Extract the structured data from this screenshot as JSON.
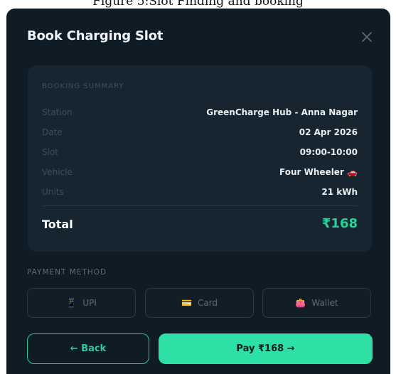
{
  "caption": "Figure 5:Slot Finding and booking",
  "modal": {
    "title": "Book Charging Slot"
  },
  "summary": {
    "heading": "BOOKING SUMMARY",
    "rows": [
      {
        "label": "Station",
        "value": "GreenCharge Hub - Anna Nagar"
      },
      {
        "label": "Date",
        "value": "02 Apr 2026"
      },
      {
        "label": "Slot",
        "value": "09:00-10:00"
      },
      {
        "label": "Vehicle",
        "value": "Four Wheeler 🚗"
      },
      {
        "label": "Units",
        "value": "21 kWh"
      }
    ],
    "total_label": "Total",
    "total_value": "₹168"
  },
  "payment": {
    "heading": "PAYMENT METHOD",
    "options": [
      {
        "icon": "📱",
        "label": "UPI"
      },
      {
        "icon": "💳",
        "label": "Card"
      },
      {
        "icon": "👛",
        "label": "Wallet"
      }
    ]
  },
  "actions": {
    "back_label": "← Back",
    "pay_label": "Pay ₹168 →"
  },
  "colors": {
    "accent": "#2ee0a5",
    "background": "#0f1b25",
    "card": "#162530"
  }
}
